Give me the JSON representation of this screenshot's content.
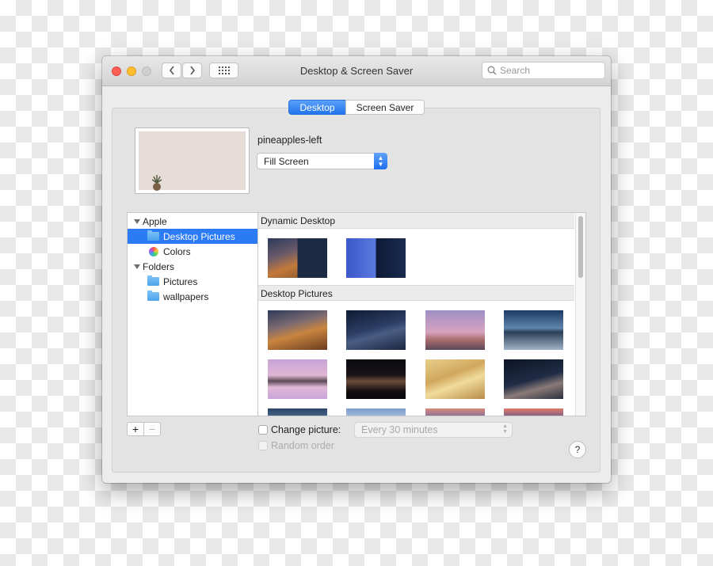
{
  "window": {
    "title": "Desktop & Screen Saver",
    "search_placeholder": "Search"
  },
  "tabs": [
    {
      "label": "Desktop",
      "selected": true
    },
    {
      "label": "Screen Saver",
      "selected": false
    }
  ],
  "current": {
    "name": "pineapples-left",
    "fit_mode": "Fill Screen"
  },
  "sidebar": {
    "groups": [
      {
        "label": "Apple",
        "items": [
          "Desktop Pictures",
          "Colors"
        ]
      },
      {
        "label": "Folders",
        "items": [
          "Pictures",
          "wallpapers"
        ]
      }
    ],
    "selected": "Desktop Pictures"
  },
  "gallery": {
    "sections": [
      {
        "title": "Dynamic Desktop",
        "count": 2
      },
      {
        "title": "Desktop Pictures",
        "count": 12
      }
    ]
  },
  "bottom": {
    "add_label": "+",
    "remove_label": "−",
    "change_picture_label": "Change picture:",
    "interval": "Every 30 minutes",
    "random_order_label": "Random order",
    "help_label": "?"
  },
  "colors": {
    "accent": "#2a7bf4",
    "window_bg": "#ececec",
    "close": "#fd5f57",
    "minimize": "#febc2e",
    "zoom_inactive": "#cfcfcf"
  }
}
